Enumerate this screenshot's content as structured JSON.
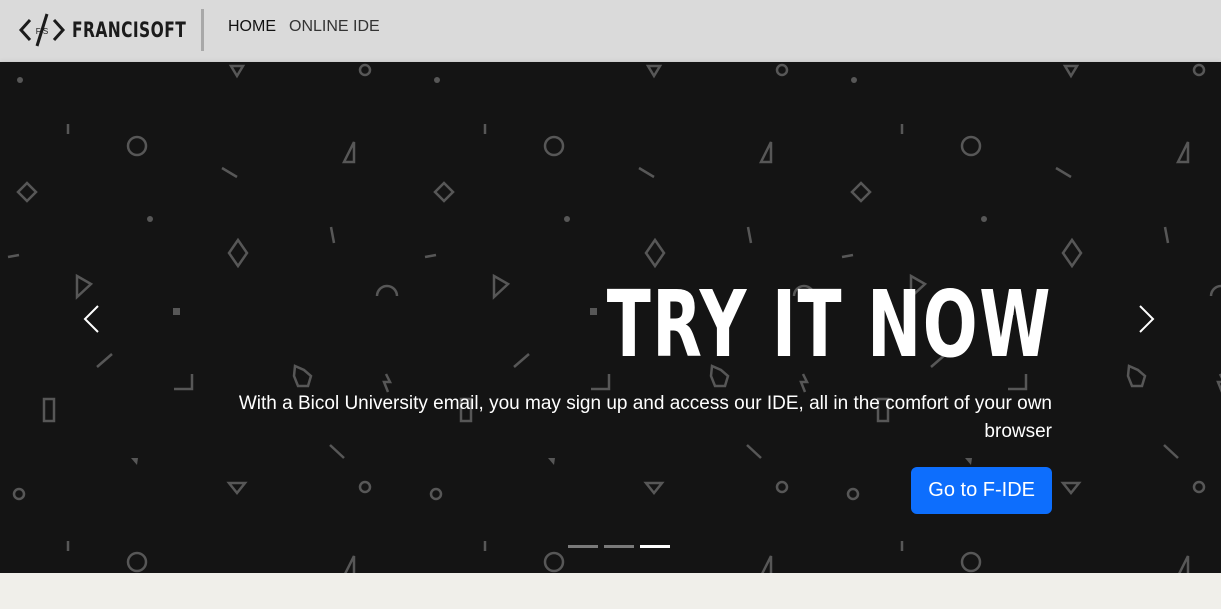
{
  "navbar": {
    "brand_name": "FRANCISOFT",
    "logo_mark": "F/S",
    "links": [
      {
        "label": "HOME"
      },
      {
        "label": "ONLINE IDE"
      }
    ]
  },
  "carousel": {
    "slide": {
      "headline": "TRY IT NOW",
      "subtext": "With a Bicol University email, you may sign up and access our IDE, all in the comfort of your own browser",
      "button_label": "Go to F-IDE"
    },
    "prev_icon": "chevron-left-icon",
    "next_icon": "chevron-right-icon",
    "slide_count": 3,
    "active_slide": 3
  },
  "colors": {
    "navbar_bg": "#dadada",
    "hero_bg": "#141414",
    "accent": "#0d6efd",
    "page_bg": "#f0efea"
  }
}
